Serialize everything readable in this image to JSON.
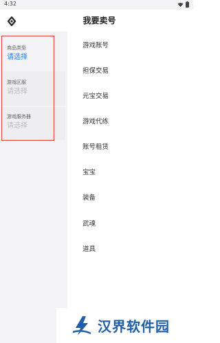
{
  "status_bar": {
    "time": "4:32"
  },
  "header": {
    "title": "我要卖号"
  },
  "sidebar": {
    "filters": [
      {
        "label": "商品类型",
        "value": "请选择"
      },
      {
        "label": "游戏区服",
        "value": "请选择"
      },
      {
        "label": "游戏服务器",
        "value": "请选择"
      }
    ]
  },
  "categories": [
    "游戏账号",
    "担保交易",
    "元宝交易",
    "游戏代练",
    "账号租赁",
    "宝宝",
    "装备",
    "武魂",
    "道具"
  ],
  "watermark": {
    "text": "汉界软件园"
  },
  "colors": {
    "accent": "#2d7ff9",
    "highlight_border": "#e53935",
    "sidebar_bg": "#f3f3f5",
    "watermark": "#1f5fa8"
  }
}
